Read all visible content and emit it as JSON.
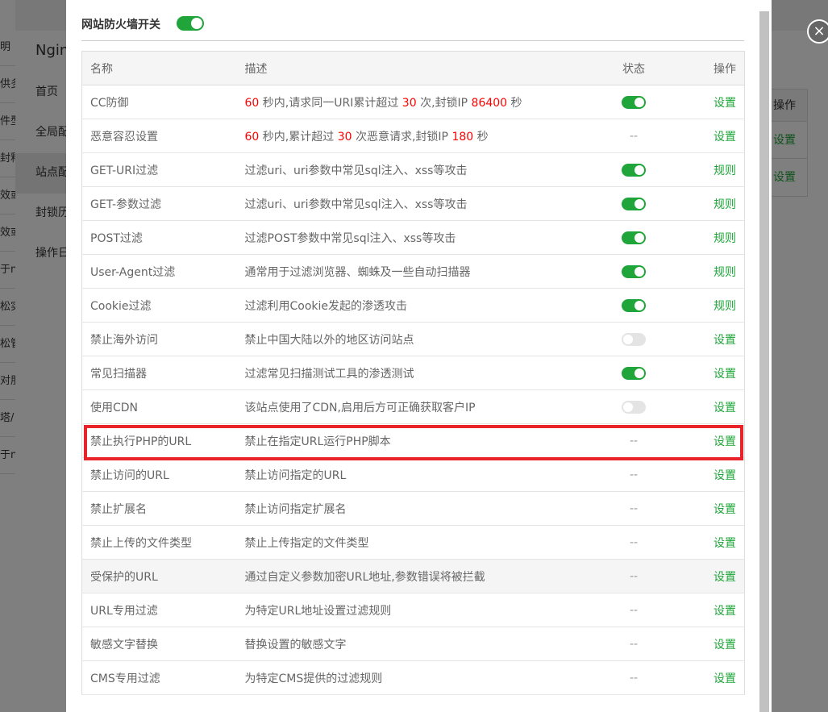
{
  "background": {
    "left_fragments": [
      "明",
      "供多",
      "件型",
      "封释",
      "效或",
      "效或",
      "于n",
      "松实",
      "松管",
      "对朋",
      "塔/",
      "于n"
    ],
    "panel_title": "Ngin",
    "nav": [
      "首页",
      "全局配",
      "站点配",
      "封锁历",
      "操作日"
    ],
    "right_table": {
      "header": "操作",
      "links": [
        "设置",
        "设置"
      ]
    }
  },
  "close_icon": "×",
  "firewall": {
    "switch_label": "网站防火墙开关",
    "switch_on": true
  },
  "table": {
    "headers": {
      "name": "名称",
      "desc": "描述",
      "status": "状态",
      "op": "操作"
    },
    "rows": [
      {
        "name": "CC防御",
        "desc_parts": [
          {
            "t": "60",
            "hl": true
          },
          {
            "t": " 秒内,请求同一URI累计超过 "
          },
          {
            "t": "30",
            "hl": true
          },
          {
            "t": " 次,封锁IP "
          },
          {
            "t": "86400",
            "hl": true
          },
          {
            "t": " 秒"
          }
        ],
        "status": "on",
        "op": "设置"
      },
      {
        "name": "恶意容忍设置",
        "desc_parts": [
          {
            "t": "60",
            "hl": true
          },
          {
            "t": " 秒内,累计超过 "
          },
          {
            "t": "30",
            "hl": true
          },
          {
            "t": " 次恶意请求,封锁IP "
          },
          {
            "t": "180",
            "hl": true
          },
          {
            "t": " 秒"
          }
        ],
        "status": "--",
        "op": "设置"
      },
      {
        "name": "GET-URI过滤",
        "desc": "过滤uri、uri参数中常见sql注入、xss等攻击",
        "status": "on",
        "op": "规则"
      },
      {
        "name": "GET-参数过滤",
        "desc": "过滤uri、uri参数中常见sql注入、xss等攻击",
        "status": "on",
        "op": "规则"
      },
      {
        "name": "POST过滤",
        "desc": "过滤POST参数中常见sql注入、xss等攻击",
        "status": "on",
        "op": "规则"
      },
      {
        "name": "User-Agent过滤",
        "desc": "通常用于过滤浏览器、蜘蛛及一些自动扫描器",
        "status": "on",
        "op": "规则"
      },
      {
        "name": "Cookie过滤",
        "desc": "过滤利用Cookie发起的渗透攻击",
        "status": "on",
        "op": "规则"
      },
      {
        "name": "禁止海外访问",
        "desc": "禁止中国大陆以外的地区访问站点",
        "status": "off",
        "op": "设置"
      },
      {
        "name": "常见扫描器",
        "desc": "过滤常见扫描测试工具的渗透测试",
        "status": "on",
        "op": "设置"
      },
      {
        "name": "使用CDN",
        "desc": "该站点使用了CDN,启用后方可正确获取客户IP",
        "status": "off",
        "op": "设置"
      },
      {
        "name": "禁止执行PHP的URL",
        "desc": "禁止在指定URL运行PHP脚本",
        "status": "--",
        "op": "设置"
      },
      {
        "name": "禁止访问的URL",
        "desc": "禁止访问指定的URL",
        "status": "--",
        "op": "设置"
      },
      {
        "name": "禁止扩展名",
        "desc": "禁止访问指定扩展名",
        "status": "--",
        "op": "设置"
      },
      {
        "name": "禁止上传的文件类型",
        "desc": "禁止上传指定的文件类型",
        "status": "--",
        "op": "设置"
      },
      {
        "name": "受保护的URL",
        "desc": "通过自定义参数加密URL地址,参数错误将被拦截",
        "status": "--",
        "op": "设置"
      },
      {
        "name": "URL专用过滤",
        "desc": "为特定URL地址设置过滤规则",
        "status": "--",
        "op": "设置"
      },
      {
        "name": "敏感文字替换",
        "desc": "替换设置的敏感文字",
        "status": "--",
        "op": "设置"
      },
      {
        "name": "CMS专用过滤",
        "desc": "为特定CMS提供的过滤规则",
        "status": "--",
        "op": "设置"
      }
    ]
  },
  "colors": {
    "accent": "#20a53a",
    "highlight_number": "#ff0000",
    "annotation_box": "#e8242a"
  }
}
